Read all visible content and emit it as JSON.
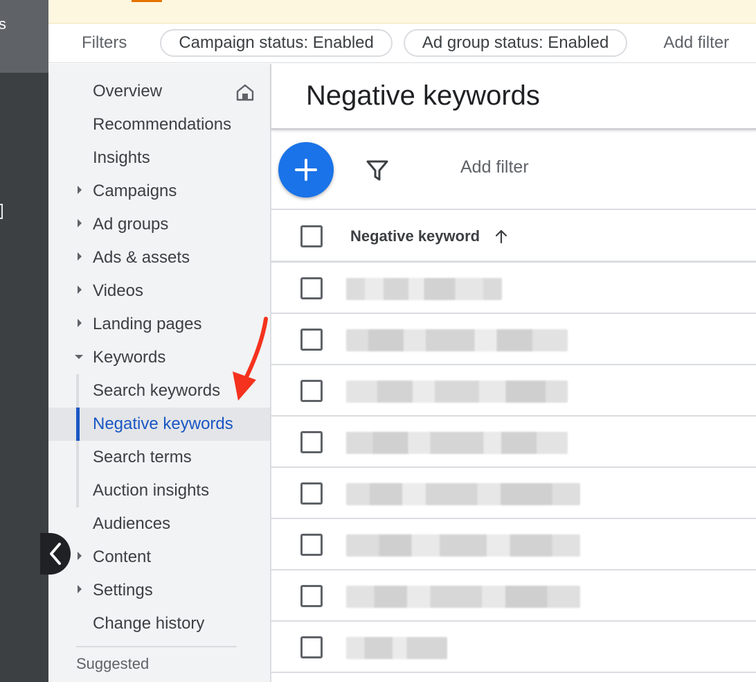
{
  "rail": {
    "top_text": "s"
  },
  "filter_bar": {
    "label": "Filters",
    "chips": [
      "Campaign status: Enabled",
      "Ad group status: Enabled"
    ],
    "add_filter": "Add filter"
  },
  "nav": {
    "items": [
      {
        "label": "Overview",
        "icon": "home-icon"
      },
      {
        "label": "Recommendations"
      },
      {
        "label": "Insights"
      },
      {
        "label": "Campaigns",
        "expandable": true
      },
      {
        "label": "Ad groups",
        "expandable": true
      },
      {
        "label": "Ads & assets",
        "expandable": true
      },
      {
        "label": "Videos",
        "expandable": true
      },
      {
        "label": "Landing pages",
        "expandable": true
      },
      {
        "label": "Keywords",
        "expanded": true
      },
      {
        "label": "Search keywords"
      },
      {
        "label": "Negative keywords",
        "active": true
      },
      {
        "label": "Search terms"
      },
      {
        "label": "Auction insights"
      },
      {
        "label": "Audiences"
      },
      {
        "label": "Content",
        "expandable": true
      },
      {
        "label": "Settings",
        "expandable": true
      },
      {
        "label": "Change history"
      }
    ],
    "suggested_label": "Suggested"
  },
  "main": {
    "title": "Negative keywords",
    "toolbar": {
      "add_filter": "Add filter"
    },
    "table": {
      "column_header": "Negative keyword",
      "sort": "ascending",
      "rows": [
        {
          "value": ""
        },
        {
          "value": ""
        },
        {
          "value": ""
        },
        {
          "value": ""
        },
        {
          "value": ""
        },
        {
          "value": ""
        },
        {
          "value": ""
        },
        {
          "value": ""
        }
      ]
    }
  },
  "colors": {
    "accent": "#1a73e8",
    "active_text": "#1a56c4",
    "annotation_arrow": "#f4321e"
  }
}
